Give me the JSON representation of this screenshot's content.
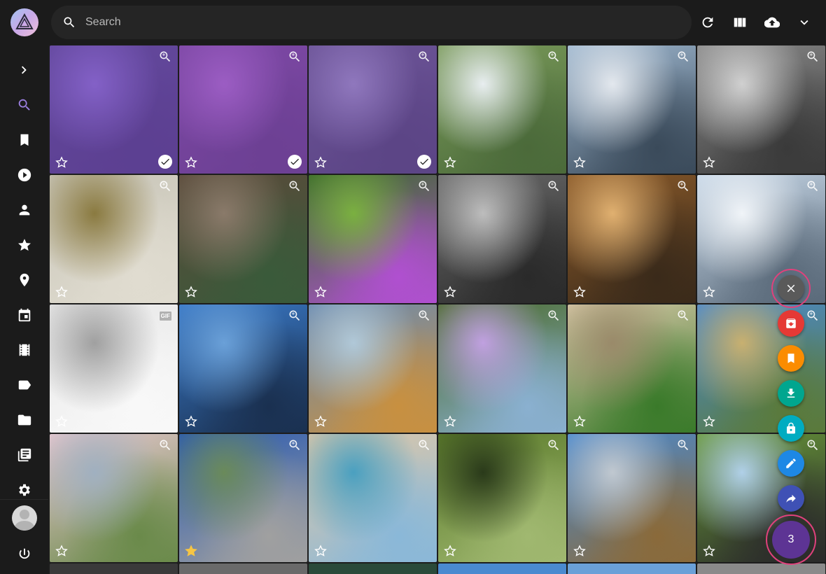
{
  "search": {
    "placeholder": "Search",
    "value": ""
  },
  "toolbar": {
    "icons": [
      "refresh-icon",
      "view-columns-icon",
      "upload-cloud-icon",
      "chevron-down-icon"
    ]
  },
  "sidebar": {
    "items": [
      {
        "name": "expand",
        "icon": "chevron-right-icon"
      },
      {
        "name": "search",
        "icon": "search-icon",
        "active": true
      },
      {
        "name": "bookmarks",
        "icon": "bookmark-icon"
      },
      {
        "name": "videos",
        "icon": "play-icon"
      },
      {
        "name": "people",
        "icon": "person-icon"
      },
      {
        "name": "favorites",
        "icon": "star-icon"
      },
      {
        "name": "places",
        "icon": "pin-icon"
      },
      {
        "name": "calendar",
        "icon": "calendar-icon"
      },
      {
        "name": "moments",
        "icon": "film-icon"
      },
      {
        "name": "labels",
        "icon": "label-icon"
      },
      {
        "name": "folders",
        "icon": "folder-icon"
      },
      {
        "name": "library",
        "icon": "library-icon"
      },
      {
        "name": "settings",
        "icon": "gear-icon"
      },
      {
        "name": "logout",
        "icon": "power-icon"
      }
    ]
  },
  "photos": [
    {
      "id": "crocus-field",
      "colors": [
        "#4a3a7a",
        "#8466c7",
        "#3d2a66"
      ],
      "selected": true,
      "favorite": false
    },
    {
      "id": "purple-azaleas",
      "colors": [
        "#7a3a8a",
        "#b05fc0",
        "#5b2b6a"
      ],
      "selected": true,
      "favorite": false
    },
    {
      "id": "white-cottage",
      "colors": [
        "#5a4f70",
        "#9a8fb5",
        "#3c3350"
      ],
      "selected": true,
      "favorite": false
    },
    {
      "id": "swan-boats",
      "colors": [
        "#7a9a5a",
        "#e8eef0",
        "#4b6a3a"
      ],
      "selected": false,
      "favorite": false
    },
    {
      "id": "harbor-tower",
      "colors": [
        "#9fb8d0",
        "#e3e8ee",
        "#3a4a5a"
      ],
      "selected": false,
      "favorite": false
    },
    {
      "id": "bridge-bw",
      "colors": [
        "#8a8a8a",
        "#d0d0d0",
        "#3a3a3a"
      ],
      "selected": false,
      "favorite": false
    },
    {
      "id": "meerkat-canvas",
      "colors": [
        "#c8c5b8",
        "#8a7a40",
        "#e0dcd0"
      ],
      "selected": false,
      "favorite": false
    },
    {
      "id": "wood-house-3",
      "colors": [
        "#5a4a3a",
        "#8a7a6a",
        "#3a5a3a"
      ],
      "selected": false,
      "favorite": false
    },
    {
      "id": "butterfly-bush",
      "colors": [
        "#3a6a2a",
        "#7ab040",
        "#b050d0"
      ],
      "selected": false,
      "favorite": false
    },
    {
      "id": "city-aerial-bw",
      "colors": [
        "#6a6a6a",
        "#bdbdbd",
        "#2a2a2a"
      ],
      "selected": false,
      "favorite": false
    },
    {
      "id": "bakery-display",
      "colors": [
        "#8a5a2a",
        "#e0b070",
        "#3a2a1a"
      ],
      "selected": false,
      "favorite": false
    },
    {
      "id": "snowy-forest",
      "colors": [
        "#c8d8e8",
        "#f0f4f8",
        "#5a6a7a"
      ],
      "selected": false,
      "favorite": false
    },
    {
      "id": "newtons-cradle",
      "colors": [
        "#e8e8e8",
        "#a0a0a0",
        "#f8f8f8"
      ],
      "selected": false,
      "favorite": false,
      "gif": "GIF"
    },
    {
      "id": "lake-reflection",
      "colors": [
        "#3a7ac8",
        "#6aa0d8",
        "#1a3050"
      ],
      "selected": false,
      "favorite": false
    },
    {
      "id": "greenhouse",
      "colors": [
        "#6a8ab0",
        "#b0c8d8",
        "#c89040"
      ],
      "selected": false,
      "favorite": false
    },
    {
      "id": "crocus-meadow",
      "colors": [
        "#4a6a2a",
        "#c0a0e0",
        "#8ab0d0"
      ],
      "selected": false,
      "favorite": false
    },
    {
      "id": "building-hedge",
      "colors": [
        "#d8c8a8",
        "#9a8a6a",
        "#3a7a2a"
      ],
      "selected": false,
      "favorite": false
    },
    {
      "id": "pergola-path",
      "colors": [
        "#4a8ad0",
        "#c8b070",
        "#5a7a3a"
      ],
      "selected": false,
      "favorite": false
    },
    {
      "id": "magnolia",
      "colors": [
        "#e8c8d0",
        "#a0b0c0",
        "#6a8a4a"
      ],
      "selected": false,
      "favorite": false
    },
    {
      "id": "peacock",
      "colors": [
        "#2a5ab0",
        "#6a8a5a",
        "#a0a0a0"
      ],
      "selected": false,
      "favorite": true
    },
    {
      "id": "beach-rocks",
      "colors": [
        "#e0c8a8",
        "#4aa0c0",
        "#8ab8d8"
      ],
      "selected": false,
      "favorite": false
    },
    {
      "id": "forest-trees",
      "colors": [
        "#5a7a2a",
        "#2a3a1a",
        "#a0b870"
      ],
      "selected": false,
      "favorite": false
    },
    {
      "id": "cement-truck",
      "colors": [
        "#4a8ad0",
        "#c0c8d0",
        "#8a6a3a"
      ],
      "selected": false,
      "favorite": false
    },
    {
      "id": "cows-field",
      "colors": [
        "#6a9a3a",
        "#b0d0e8",
        "#2a2a2a"
      ],
      "selected": false,
      "favorite": false
    }
  ],
  "actions": {
    "close_icon": "close-icon",
    "items": [
      {
        "name": "archive",
        "icon": "archive-icon",
        "color": "#e53935"
      },
      {
        "name": "bookmark",
        "icon": "bookmark-icon",
        "color": "#fb8c00"
      },
      {
        "name": "download",
        "icon": "download-icon",
        "color": "#00a68f"
      },
      {
        "name": "private",
        "icon": "lock-icon",
        "color": "#00acc1"
      },
      {
        "name": "edit",
        "icon": "pencil-icon",
        "color": "#1e88e5"
      },
      {
        "name": "share",
        "icon": "share-icon",
        "color": "#3f51b5"
      }
    ],
    "selected_count": "3"
  },
  "colors": {
    "accent": "#9b7fe0",
    "ring": "#e0417c",
    "count_bg": "#5d3494"
  }
}
